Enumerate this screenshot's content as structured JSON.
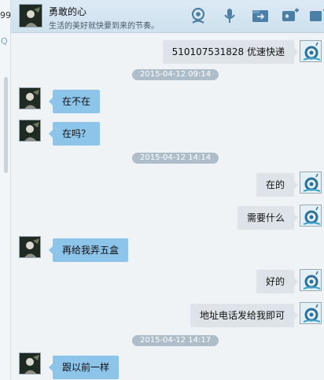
{
  "sidebar": {
    "partial_number": "99",
    "search_glyph": "Q"
  },
  "header": {
    "contact_name": "勇敢的心",
    "signature": "生活的美好就快要到来的节奏。",
    "tools": [
      {
        "name": "video-call-icon"
      },
      {
        "name": "voice-call-icon"
      },
      {
        "name": "file-transfer-icon"
      },
      {
        "name": "remote-assist-icon"
      },
      {
        "name": "app-launch-icon"
      }
    ]
  },
  "messages": {
    "m1": "510107531828 优速快递",
    "ts1": "2015-04-12 09:14",
    "m2": "在不在",
    "m3": "在吗？",
    "ts2": "2015-04-12 14:14",
    "m4": "在的",
    "m5": "需要什么",
    "m6": "再给我弄五盒",
    "m7": "好的",
    "m8": "地址电话发给我即可",
    "ts3": "2015-04-12 14:17",
    "m9": "跟以前一样"
  },
  "colors": {
    "incoming_bubble": "#8dc4ea",
    "outgoing_bubble": "#dde3e8",
    "timestamp_pill": "#aebdca",
    "header_bg": "#d4e5f1"
  }
}
